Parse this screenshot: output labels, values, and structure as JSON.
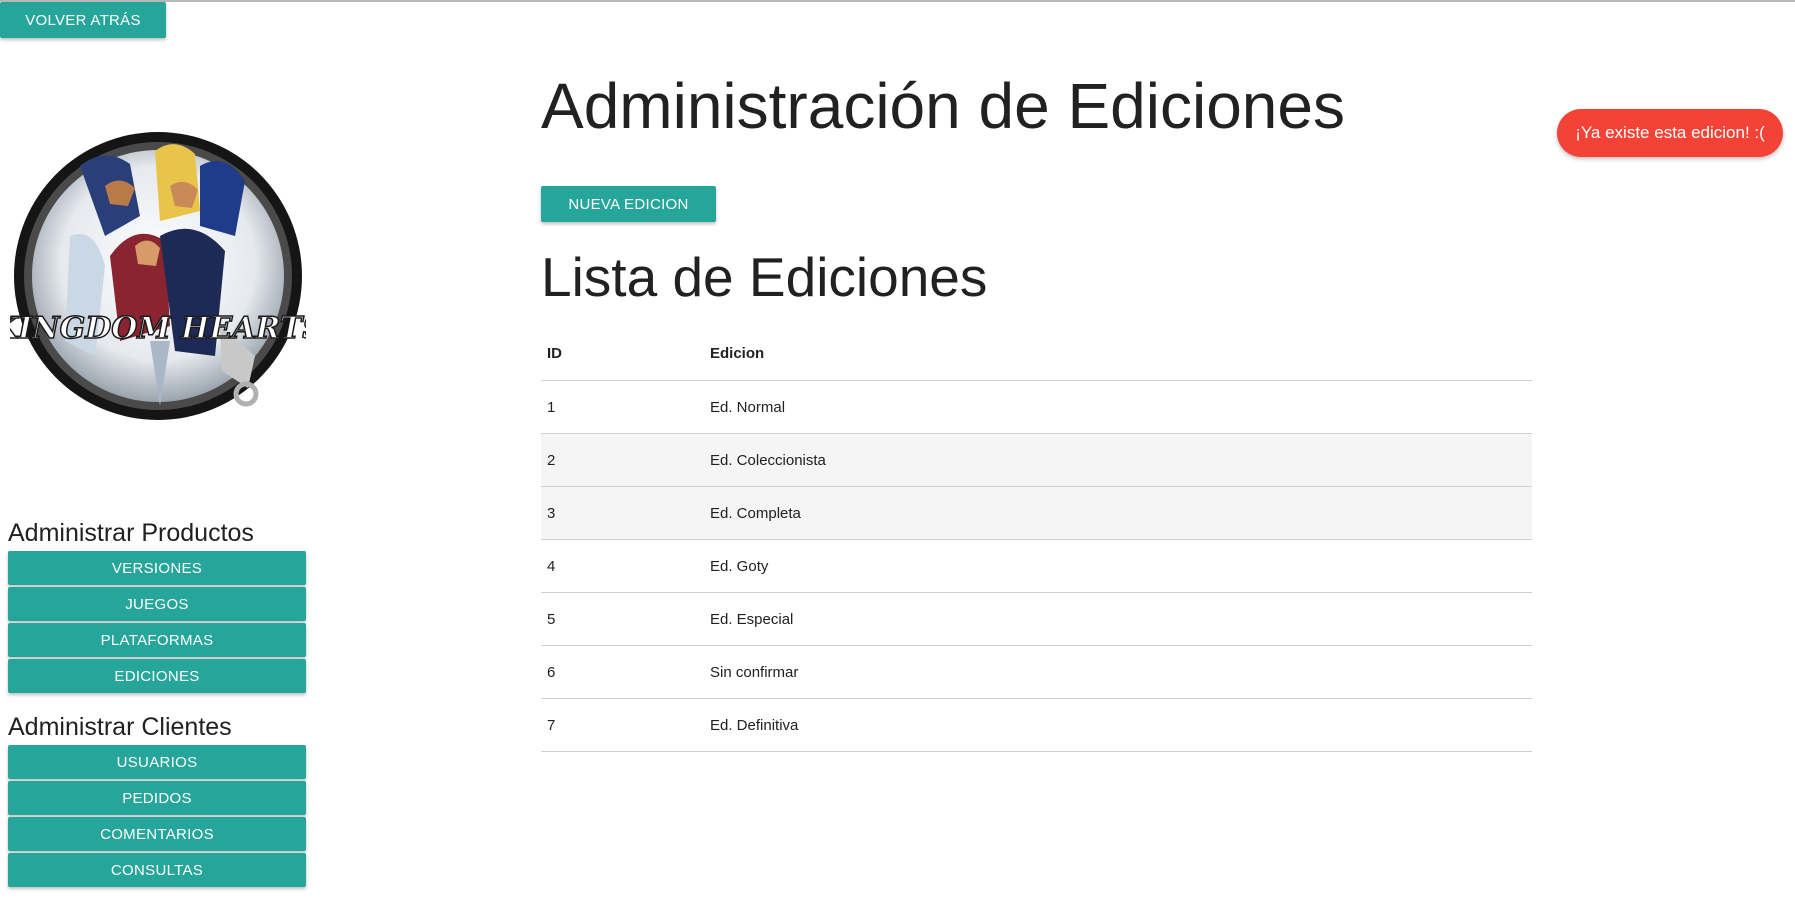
{
  "header": {
    "back_label": "Volver atrás"
  },
  "logo": {
    "alt": "Kingdom Hearts II",
    "wordmark": "KINGDOM HEARTS"
  },
  "sidebar": {
    "products": {
      "heading": "Administrar Productos",
      "items": [
        {
          "label": "Versiones"
        },
        {
          "label": "Juegos"
        },
        {
          "label": "Plataformas"
        },
        {
          "label": "Ediciones"
        }
      ]
    },
    "clients": {
      "heading": "Administrar Clientes",
      "items": [
        {
          "label": "Usuarios"
        },
        {
          "label": "Pedidos"
        },
        {
          "label": "Comentarios"
        },
        {
          "label": "Consultas"
        }
      ]
    }
  },
  "main": {
    "title": "Administración de Ediciones",
    "new_button_label": "Nueva edicion",
    "list_title": "Lista de Ediciones",
    "table": {
      "columns": [
        "ID",
        "Edicion"
      ],
      "rows": [
        {
          "id": "1",
          "edicion": "Ed. Normal"
        },
        {
          "id": "2",
          "edicion": "Ed. Coleccionista"
        },
        {
          "id": "3",
          "edicion": "Ed. Completa"
        },
        {
          "id": "4",
          "edicion": "Ed. Goty"
        },
        {
          "id": "5",
          "edicion": "Ed. Especial"
        },
        {
          "id": "6",
          "edicion": "Sin confirmar"
        },
        {
          "id": "7",
          "edicion": "Ed. Definitiva"
        }
      ]
    }
  },
  "toast": {
    "message": "¡Ya existe esta edicion! :("
  },
  "colors": {
    "accent": "#26a69a",
    "toast": "#f44336",
    "text": "#212121"
  }
}
